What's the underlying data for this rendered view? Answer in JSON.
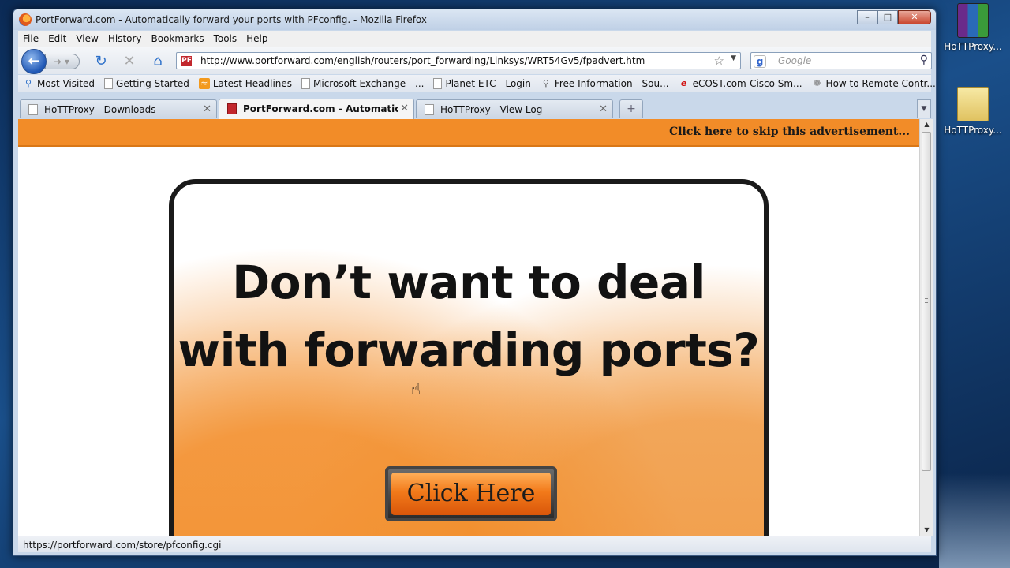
{
  "window": {
    "title": "PortForward.com - Automatically forward your ports with PFconfig. - Mozilla Firefox"
  },
  "menu": [
    "File",
    "Edit",
    "View",
    "History",
    "Bookmarks",
    "Tools",
    "Help"
  ],
  "nav": {
    "url": "http://www.portforward.com/english/routers/port_forwarding/Linksys/WRT54Gv5/fpadvert.htm",
    "search_placeholder": "Google"
  },
  "bookmarks": [
    {
      "label": "Most Visited",
      "icon": "most-visited-icon"
    },
    {
      "label": "Getting Started",
      "icon": "page-icon"
    },
    {
      "label": "Latest Headlines",
      "icon": "rss-icon"
    },
    {
      "label": "Microsoft Exchange - ...",
      "icon": "page-icon"
    },
    {
      "label": "Planet ETC - Login",
      "icon": "page-icon"
    },
    {
      "label": "Free Information - Sou...",
      "icon": "search-icon"
    },
    {
      "label": "eCOST.com-Cisco Sm...",
      "icon": "ecost-icon"
    },
    {
      "label": "How to Remote Contr...",
      "icon": "puzzle-icon"
    }
  ],
  "tabs": [
    {
      "label": "HoTTProxy - Downloads",
      "active": false
    },
    {
      "label": "PortForward.com - Automatically ...",
      "active": true
    },
    {
      "label": "HoTTProxy - View Log",
      "active": false
    }
  ],
  "page": {
    "skip_link": "Click here to skip this advertisement...",
    "headline_line1": "Don’t want to deal",
    "headline_line2": "with forwarding ports?",
    "cta_label": "Click Here",
    "accent_color": "#f28c28"
  },
  "status": {
    "text": "https://portforward.com/store/pfconfig.cgi"
  },
  "desktop": {
    "icons": [
      {
        "label": "HoTTProxy...",
        "icon": "winrar-archive-icon"
      },
      {
        "label": "HoTTProxy...",
        "icon": "folder-icon"
      }
    ]
  }
}
